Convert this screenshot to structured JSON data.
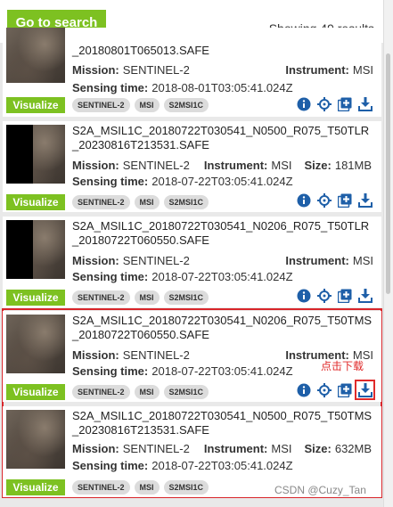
{
  "header": {
    "go_to_search_label": "Go to search",
    "results_text": "Showing 49 results"
  },
  "results": [
    {
      "name_line1": "",
      "name_line2": "_20180801T065013.SAFE",
      "mission_label": "Mission:",
      "mission": "SENTINEL-2",
      "instrument_label": "Instrument:",
      "instrument": "MSI",
      "size_label": "",
      "size": "",
      "sensing_label": "Sensing time:",
      "sensing_time": "2018-08-01T03:05:41.024Z",
      "visualize_label": "Visualize",
      "tags": [
        "SENTINEL-2",
        "MSI",
        "S2MSI1C"
      ]
    },
    {
      "name_line1": "S2A_MSIL1C_20180722T030541_N0500_R075_T50TLR",
      "name_line2": "_20230816T213531.SAFE",
      "mission_label": "Mission:",
      "mission": "SENTINEL-2",
      "instrument_label": "Instrument:",
      "instrument": "MSI",
      "size_label": "Size:",
      "size": "181MB",
      "sensing_label": "Sensing time:",
      "sensing_time": "2018-07-22T03:05:41.024Z",
      "visualize_label": "Visualize",
      "tags": [
        "SENTINEL-2",
        "MSI",
        "S2MSI1C"
      ]
    },
    {
      "name_line1": "S2A_MSIL1C_20180722T030541_N0206_R075_T50TLR",
      "name_line2": "_20180722T060550.SAFE",
      "mission_label": "Mission:",
      "mission": "SENTINEL-2",
      "instrument_label": "Instrument:",
      "instrument": "MSI",
      "size_label": "",
      "size": "",
      "sensing_label": "Sensing time:",
      "sensing_time": "2018-07-22T03:05:41.024Z",
      "visualize_label": "Visualize",
      "tags": [
        "SENTINEL-2",
        "MSI",
        "S2MSI1C"
      ]
    },
    {
      "name_line1": "S2A_MSIL1C_20180722T030541_N0206_R075_T50TMS",
      "name_line2": "_20180722T060550.SAFE",
      "mission_label": "Mission:",
      "mission": "SENTINEL-2",
      "instrument_label": "Instrument:",
      "instrument": "MSI",
      "size_label": "",
      "size": "",
      "sensing_label": "Sensing time:",
      "sensing_time": "2018-07-22T03:05:41.024Z",
      "visualize_label": "Visualize",
      "tags": [
        "SENTINEL-2",
        "MSI",
        "S2MSI1C"
      ]
    },
    {
      "name_line1": "S2A_MSIL1C_20180722T030541_N0500_R075_T50TMS",
      "name_line2": "_20230816T213531.SAFE",
      "mission_label": "Mission:",
      "mission": "SENTINEL-2",
      "instrument_label": "Instrument:",
      "instrument": "MSI",
      "size_label": "Size:",
      "size": "632MB",
      "sensing_label": "Sensing time:",
      "sensing_time": "2018-07-22T03:05:41.024Z",
      "visualize_label": "Visualize",
      "tags": [
        "SENTINEL-2",
        "MSI",
        "S2MSI1C"
      ]
    }
  ],
  "annotation": "点击下载",
  "watermark": "CSDN @Cuzy_Tan",
  "colors": {
    "accent_green": "#7dc121",
    "icon_blue": "#1e5fa8",
    "highlight_red": "#e02a2a"
  },
  "icons": [
    "info-icon",
    "crosshair-icon",
    "add-to-cart-icon",
    "download-icon"
  ]
}
